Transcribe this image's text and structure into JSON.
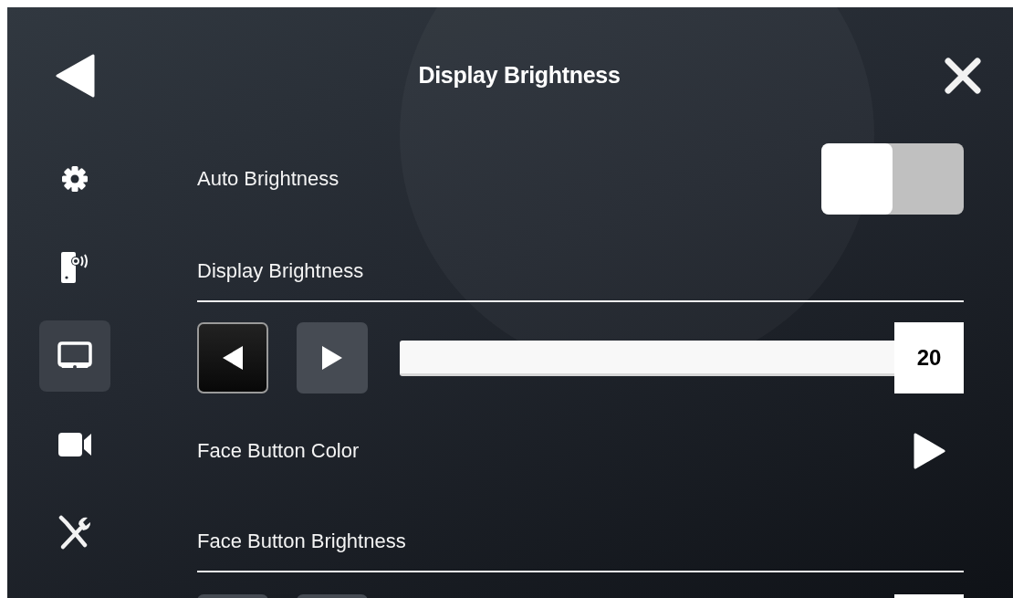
{
  "header": {
    "title": "Display Brightness"
  },
  "sidebar": {
    "items": [
      {
        "kind": "settings",
        "selected": false
      },
      {
        "kind": "device",
        "selected": false
      },
      {
        "kind": "display",
        "selected": true
      },
      {
        "kind": "camera",
        "selected": false
      },
      {
        "kind": "tools",
        "selected": false
      }
    ]
  },
  "settings": [
    {
      "kind": "toggle",
      "label": "Auto Brightness",
      "on": false
    },
    {
      "kind": "section",
      "label": "Display Brightness"
    },
    {
      "kind": "slider",
      "level": 1,
      "value": "20",
      "decrease_pressed": true,
      "increase_pressed": false
    },
    {
      "kind": "link",
      "label": "Face Button Color"
    },
    {
      "kind": "section",
      "label": "Face Button Brightness"
    },
    {
      "kind": "slider_cut",
      "decrease_pressed": false,
      "increase_pressed": false
    }
  ]
}
